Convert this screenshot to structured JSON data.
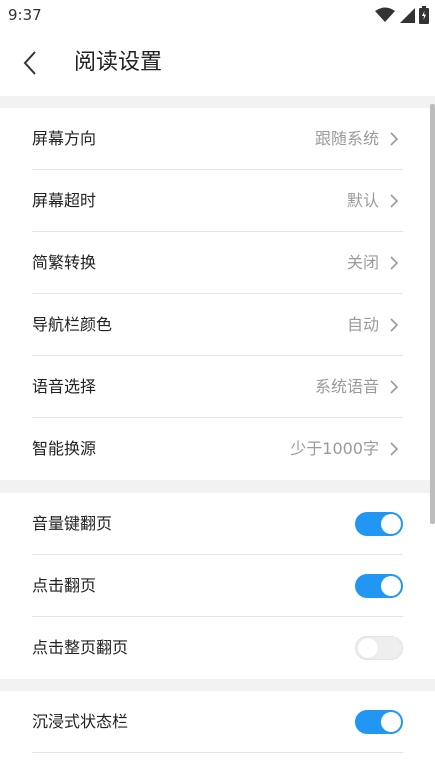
{
  "status_bar": {
    "time": "9:37",
    "icons": [
      "wifi-icon",
      "signal-icon",
      "battery-icon"
    ]
  },
  "app_bar": {
    "title": "阅读设置",
    "back_icon": "back-arrow-icon"
  },
  "groups": [
    {
      "items": [
        {
          "label": "屏幕方向",
          "value": "跟随系统"
        },
        {
          "label": "屏幕超时",
          "value": "默认"
        },
        {
          "label": "简繁转换",
          "value": "关闭"
        },
        {
          "label": "导航栏颜色",
          "value": "自动"
        },
        {
          "label": "语音选择",
          "value": "系统语音"
        },
        {
          "label": "智能换源",
          "value": "少于1000字"
        }
      ]
    },
    {
      "items": [
        {
          "label": "音量键翻页",
          "on": true
        },
        {
          "label": "点击翻页",
          "on": true
        },
        {
          "label": "点击整页翻页",
          "on": false
        }
      ]
    },
    {
      "items": [
        {
          "label": "沉浸式状态栏",
          "on": true
        }
      ]
    }
  ],
  "colors": {
    "accent": "#2196f3",
    "toggle_off": "#eeeeee",
    "band": "#f2f2f2",
    "value_text": "#9a9a9a"
  }
}
